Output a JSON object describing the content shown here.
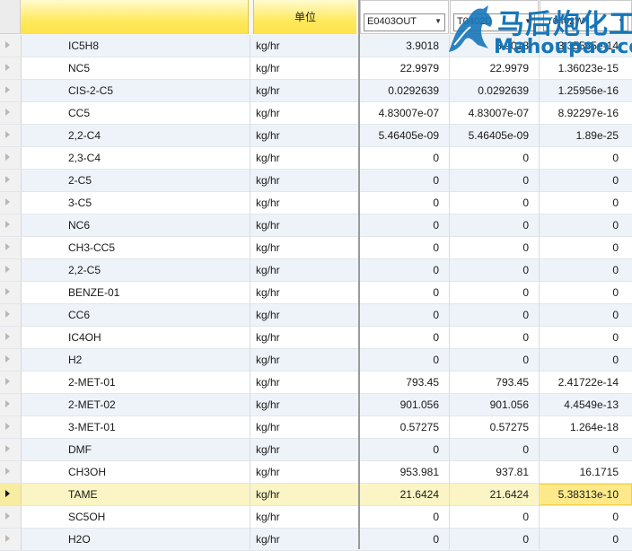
{
  "header": {
    "unit_label": "单位",
    "columns": [
      "E0403OUT",
      "T0402D",
      "T0402W"
    ]
  },
  "watermark": {
    "line1": "马后炮化工",
    "line2": "Mahoupao.com"
  },
  "rows": [
    {
      "name": "IC5H8",
      "unit": "kg/hr",
      "v1": "3.9018",
      "v2": "3.9018",
      "v3": "3.35565e-14"
    },
    {
      "name": "NC5",
      "unit": "kg/hr",
      "v1": "22.9979",
      "v2": "22.9979",
      "v3": "1.36023e-15"
    },
    {
      "name": "CIS-2-C5",
      "unit": "kg/hr",
      "v1": "0.0292639",
      "v2": "0.0292639",
      "v3": "1.25956e-16"
    },
    {
      "name": "CC5",
      "unit": "kg/hr",
      "v1": "4.83007e-07",
      "v2": "4.83007e-07",
      "v3": "8.92297e-16"
    },
    {
      "name": "2,2-C4",
      "unit": "kg/hr",
      "v1": "5.46405e-09",
      "v2": "5.46405e-09",
      "v3": "1.89e-25"
    },
    {
      "name": "2,3-C4",
      "unit": "kg/hr",
      "v1": "0",
      "v2": "0",
      "v3": "0"
    },
    {
      "name": "2-C5",
      "unit": "kg/hr",
      "v1": "0",
      "v2": "0",
      "v3": "0"
    },
    {
      "name": "3-C5",
      "unit": "kg/hr",
      "v1": "0",
      "v2": "0",
      "v3": "0"
    },
    {
      "name": "NC6",
      "unit": "kg/hr",
      "v1": "0",
      "v2": "0",
      "v3": "0"
    },
    {
      "name": "CH3-CC5",
      "unit": "kg/hr",
      "v1": "0",
      "v2": "0",
      "v3": "0"
    },
    {
      "name": "2,2-C5",
      "unit": "kg/hr",
      "v1": "0",
      "v2": "0",
      "v3": "0"
    },
    {
      "name": "BENZE-01",
      "unit": "kg/hr",
      "v1": "0",
      "v2": "0",
      "v3": "0"
    },
    {
      "name": "CC6",
      "unit": "kg/hr",
      "v1": "0",
      "v2": "0",
      "v3": "0"
    },
    {
      "name": "IC4OH",
      "unit": "kg/hr",
      "v1": "0",
      "v2": "0",
      "v3": "0"
    },
    {
      "name": "H2",
      "unit": "kg/hr",
      "v1": "0",
      "v2": "0",
      "v3": "0"
    },
    {
      "name": "2-MET-01",
      "unit": "kg/hr",
      "v1": "793.45",
      "v2": "793.45",
      "v3": "2.41722e-14"
    },
    {
      "name": "2-MET-02",
      "unit": "kg/hr",
      "v1": "901.056",
      "v2": "901.056",
      "v3": "4.4549e-13"
    },
    {
      "name": "3-MET-01",
      "unit": "kg/hr",
      "v1": "0.57275",
      "v2": "0.57275",
      "v3": "1.264e-18"
    },
    {
      "name": "DMF",
      "unit": "kg/hr",
      "v1": "0",
      "v2": "0",
      "v3": "0"
    },
    {
      "name": "CH3OH",
      "unit": "kg/hr",
      "v1": "953.981",
      "v2": "937.81",
      "v3": "16.1715"
    },
    {
      "name": "TAME",
      "unit": "kg/hr",
      "v1": "21.6424",
      "v2": "21.6424",
      "v3": "5.38313e-10",
      "current": true
    },
    {
      "name": "SC5OH",
      "unit": "kg/hr",
      "v1": "0",
      "v2": "0",
      "v3": "0"
    },
    {
      "name": "H2O",
      "unit": "kg/hr",
      "v1": "0",
      "v2": "0",
      "v3": "0"
    }
  ]
}
